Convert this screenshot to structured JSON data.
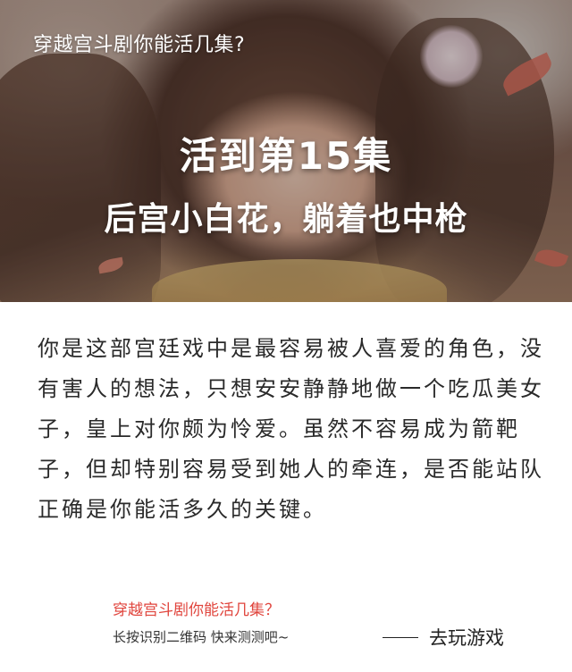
{
  "hero": {
    "quiz_title": "穿越宫斗剧你能活几集?",
    "result_headline": "活到第15集",
    "result_subtitle": "后宫小白花，躺着也中枪"
  },
  "description": {
    "text": "你是这部宫廷戏中是最容易被人喜爱的角色，没有害人的想法，只想安安静静地做一个吃瓜美女子，皇上对你颇为怜爱。虽然不容易成为箭靶子，但却特别容易受到她人的牵连，是否能站队正确是你能活多久的关键。"
  },
  "footer": {
    "title": "穿越宫斗剧你能活几集？",
    "subtitle": "长按识别二维码   快来测测吧~",
    "signature": "去玩游戏"
  },
  "colors": {
    "footer_accent": "#e0443c",
    "headline_text": "#ffffff",
    "body_text": "#2a2a2a"
  }
}
